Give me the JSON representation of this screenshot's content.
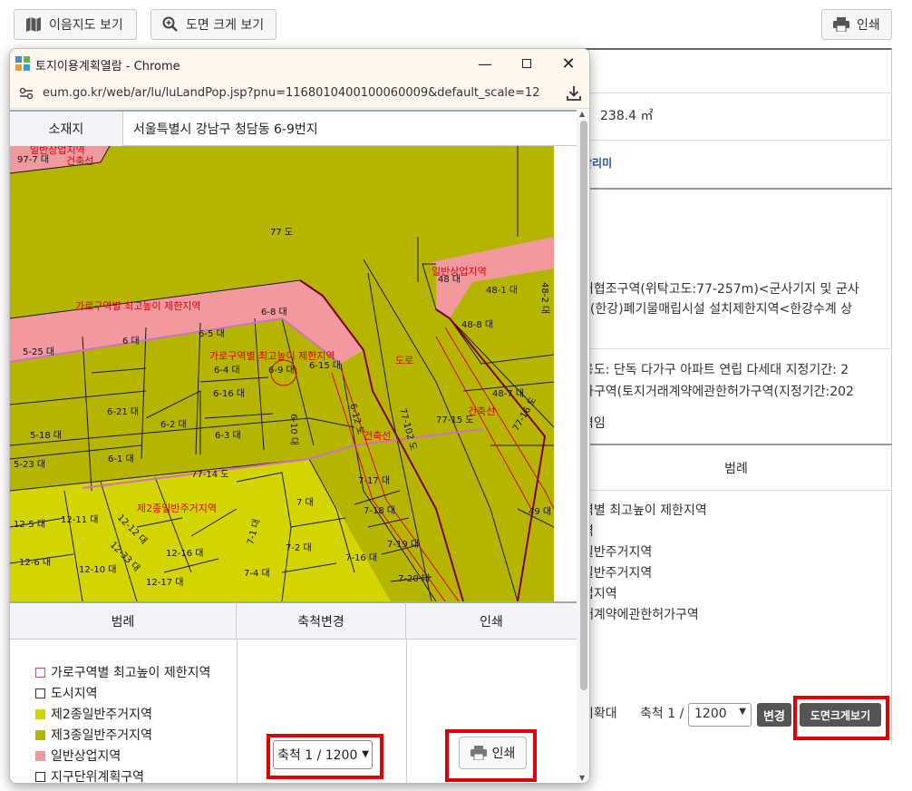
{
  "toolbar": {
    "map_view_label": "이음지도 보기",
    "large_view_label": "도면 크게 보기",
    "print_label": "인쇄"
  },
  "background": {
    "area": "238.4 ㎡",
    "link_text": "갈리미",
    "text_line1": "거협조구역(위탁고도:77-257m)<군사기지 및 군사",
    "text_line2": ", (한강)폐기물매립시설 설치제한지역<한강수계 상",
    "text_line3": "용도: 단독 다가구 아파트 연립 다세대 지정기간: 2",
    "text_line4": "가구역(토지거래계약에관한허가구역(지정기간:202",
    "text_line5": "격임",
    "legend_header": "범례",
    "legend_items": [
      "역별 최고높이 제한지역",
      "역",
      "일반주거지역",
      "일반주거지역",
      "업지역",
      "래계약에관한허가구역"
    ],
    "zoom_label": "시확대",
    "scale_label": "축척 1 /",
    "scale_value": "1200",
    "change_button": "변경",
    "large_button": "도면크게보기"
  },
  "popup": {
    "title": "토지이용계획열람 - Chrome",
    "url": "eum.go.kr/web/ar/lu/luLandPop.jsp?pnu=1168010400100060009&default_scale=120...",
    "location_label": "소재지",
    "location_value": "서울특별시 강남구 청담동 6-9번지",
    "legend_header": "범례",
    "scale_header": "축척변경",
    "print_header": "인쇄",
    "legend_items": [
      {
        "label": "가로구역별 최고높이 제한지역",
        "color": "#ffffff",
        "border": "#c040c0"
      },
      {
        "label": "도시지역",
        "color": "#ffffff",
        "border": "#333333"
      },
      {
        "label": "제2종일반주거지역",
        "color": "#d4d400",
        "border": "#d4d400"
      },
      {
        "label": "제3종일반주거지역",
        "color": "#b5b500",
        "border": "#b5b500"
      },
      {
        "label": "일반상업지역",
        "color": "#f2999f",
        "border": "#f2999f"
      },
      {
        "label": "지구단위계획구역",
        "color": "#ffffff",
        "border": "#222288"
      }
    ],
    "scale_select_value": "축척 1 / 1200",
    "print_button": "인쇄"
  },
  "map": {
    "labels": {
      "zone_limit_1": "가로구역별 최고높이 제한지역",
      "zone_limit_2": "가로구역별 최고높이 제한지역",
      "general_commercial": "일반상업지역",
      "road": "도로",
      "building_line_1": "건축선",
      "building_line_2": "건축선",
      "second_res": "제2종일반주거지역",
      "top_left": "일반상업지역",
      "top_left2": "건축선"
    },
    "parcels": [
      "97-7 대",
      "77 도",
      "6-8 대",
      "6-5 대",
      "6 대",
      "5-25 대",
      "6-4 대",
      "6-9 대",
      "6-15 대",
      "6-16 대",
      "6-21 대",
      "6-2 대",
      "6-3 대",
      "5-18 대",
      "6-1 대",
      "5-23 대",
      "6-10 대",
      "6-12 도",
      "77-102 도",
      "77-15 도",
      "48 대",
      "48-1 대",
      "48-2 대",
      "48-8 대",
      "48-7 대",
      "77-16 도",
      "77-14 도",
      "7 대",
      "7-17 대",
      "7-18 대",
      "7-19 대",
      "7-16 대",
      "7-20 대",
      "7-2 대",
      "7-4 대",
      "7-1 대",
      "12-5 대",
      "12-11 대",
      "12-12 대",
      "12-33 대",
      "12-16 대",
      "12-6 대",
      "12-10 대",
      "12-17 대",
      "49 대"
    ]
  },
  "colors": {
    "accent_red": "#e00000",
    "res3": "#b5b500",
    "res2": "#d4d400",
    "commercial": "#f2999f"
  }
}
